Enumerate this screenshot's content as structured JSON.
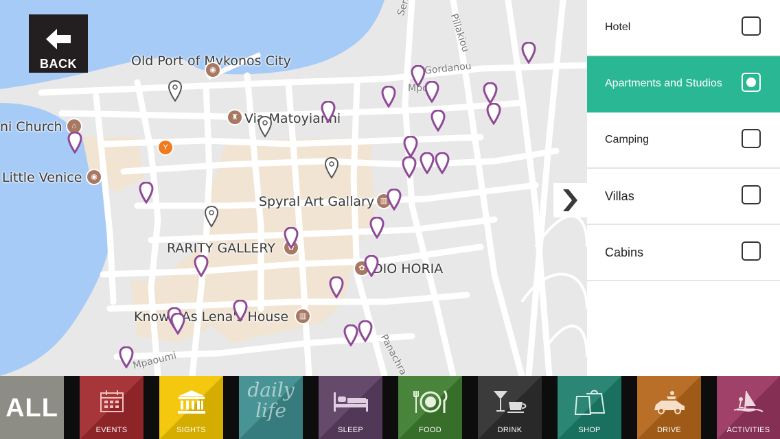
{
  "navigation": {
    "back_label": "BACK"
  },
  "map": {
    "place_labels": [
      "Old Port of Mykonos City",
      "Via Matoyianni",
      "ni Church",
      "Little Venice",
      "Spyral Art Gallary",
      "RARITY GALLERY",
      "DIO HORIA",
      "Known As Lena's House"
    ],
    "street_labels": [
      "Serakou",
      "Pillakiou",
      "Gordanou",
      "Mpoin",
      "Mpaoumi",
      "Panachra"
    ]
  },
  "filter_panel": {
    "options": [
      {
        "label": "Hotel",
        "checked": false
      },
      {
        "label": "Apartments and Studios",
        "checked": true
      },
      {
        "label": "Camping",
        "checked": false
      },
      {
        "label": "Villas",
        "checked": false
      },
      {
        "label": "Cabins",
        "checked": false
      }
    ],
    "selected_color": "#2ab793"
  },
  "categories": [
    {
      "label": "ALL",
      "color": "#8d8d85"
    },
    {
      "label": "EVENTS",
      "color": "#a02a2d",
      "icon": "calendar-icon"
    },
    {
      "label": "SIGHTS",
      "color": "#f2c500",
      "icon": "temple-icon"
    },
    {
      "label": "daily life",
      "color": "#3d8c8e"
    },
    {
      "label": "SLEEP",
      "color": "#5c3f63",
      "icon": "bed-icon"
    },
    {
      "label": "FOOD",
      "color": "#3f7d30",
      "icon": "plate-icon"
    },
    {
      "label": "DRINK",
      "color": "#2f2f2f",
      "icon": "cocktail-icon"
    },
    {
      "label": "SHOP",
      "color": "#1e7f6c",
      "icon": "shopping-bag-icon"
    },
    {
      "label": "DRIVE",
      "color": "#b5661a",
      "icon": "car-icon"
    },
    {
      "label": "ACTIVITIES",
      "color": "#993560",
      "icon": "windsurf-icon"
    }
  ],
  "colors": {
    "pin_purple": "#8f4a97",
    "pin_outline": "#555555",
    "water": "#a6cbf6",
    "old_town": "#f1e4d3"
  }
}
